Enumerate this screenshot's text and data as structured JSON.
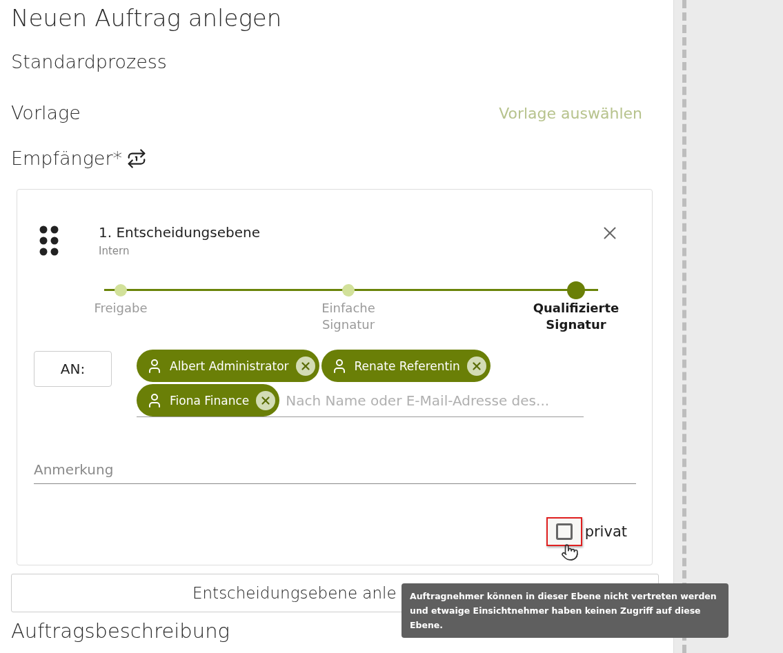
{
  "title": "Neuen Auftrag anlegen",
  "process": "Standardprozess",
  "template": {
    "label": "Vorlage",
    "action": "Vorlage auswählen"
  },
  "recipients": {
    "label": "Empfänger*"
  },
  "level": {
    "title": "1. Entscheidungsebene",
    "subtitle": "Intern",
    "steps": [
      {
        "label": "Freigabe",
        "selected": false
      },
      {
        "label": "Einfache Signatur",
        "selected": false
      },
      {
        "label": "Qualifizierte Signatur",
        "selected": true
      }
    ],
    "to_label": "AN:",
    "chips": [
      {
        "name": "Albert Administrator"
      },
      {
        "name": "Renate Referentin"
      },
      {
        "name": "Fiona Finance"
      }
    ],
    "search_placeholder": "Nach Name oder E-Mail-Adresse des...",
    "note_placeholder": "Anmerkung",
    "private": {
      "label": "privat",
      "checked": false
    }
  },
  "add_button": "Entscheidungsebene anle",
  "description_heading": "Auftragsbeschreibung",
  "tooltip": "Auftragnehmer können in dieser Ebene nicht vertreten werden und etwaige Einsichtnehmer haben keinen Zugriff auf diese Ebene."
}
